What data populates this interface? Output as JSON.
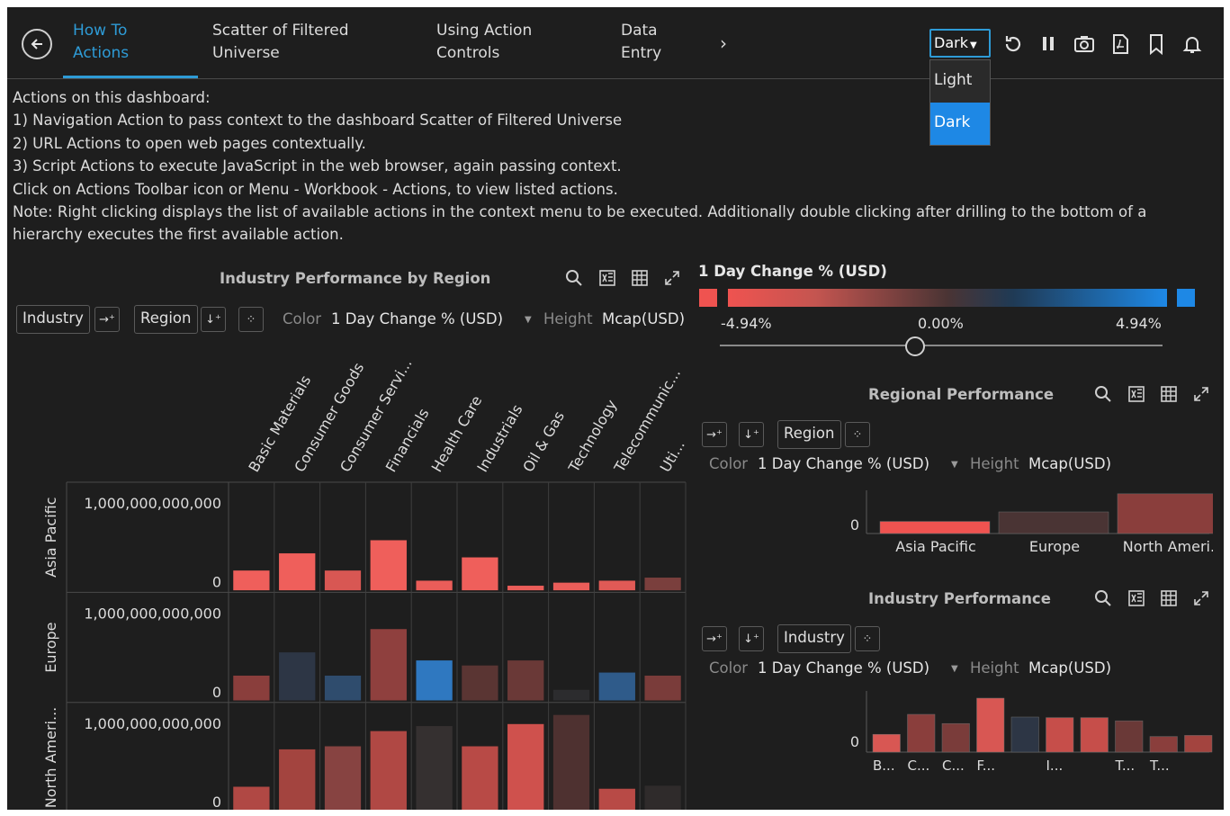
{
  "nav": {
    "tabs": [
      {
        "label_1": "How To",
        "label_2": "Actions"
      },
      {
        "label_1": "Scatter of Filtered",
        "label_2": "Universe"
      },
      {
        "label_1": "Using Action",
        "label_2": "Controls"
      },
      {
        "label_1": "Data",
        "label_2": "Entry"
      }
    ],
    "more": "›",
    "theme": {
      "selected": "Dark",
      "options": [
        "Light",
        "Dark"
      ]
    },
    "toolbar_icons": [
      "refresh-icon",
      "pause-icon",
      "camera-icon",
      "pdf-icon",
      "bookmark-icon",
      "bell-icon"
    ]
  },
  "description": {
    "lines": [
      "Actions on this dashboard:",
      "1) Navigation Action to pass context to the dashboard Scatter of Filtered Universe",
      "2) URL Actions to open web pages contextually.",
      "3) Script Actions to execute JavaScript in the web browser, again passing context.",
      "Click on Actions Toolbar icon or Menu - Workbook - Actions, to view listed actions.",
      "Note: Right clicking displays the list of available actions in the context menu to be executed.   Additionally double clicking after drilling to the bottom of a",
      "hierarchy executes the first available action."
    ]
  },
  "left_panel": {
    "title": "Industry Performance by Region",
    "dim1": "Industry",
    "dim2": "Region",
    "color_label": "Color",
    "color_value": "1 Day Change % (USD)",
    "height_label": "Height",
    "height_value": "Mcap(USD)"
  },
  "legend": {
    "title": "1 Day Change % (USD)",
    "min": "-4.94%",
    "mid": "0.00%",
    "max": "4.94%",
    "neg_color": "#ef5350",
    "pos_color": "#1e88e5"
  },
  "regional_panel": {
    "title": "Regional Performance",
    "dim": "Region",
    "color_label": "Color",
    "color_value": "1 Day Change % (USD)",
    "height_label": "Height",
    "height_value": "Mcap(USD)"
  },
  "industry_panel": {
    "title": "Industry Performance",
    "dim": "Industry",
    "color_label": "Color",
    "color_value": "1 Day Change % (USD)",
    "height_label": "Height",
    "height_value": "Mcap(USD)"
  },
  "chart_data": [
    {
      "type": "bar",
      "name": "Industry Performance by Region",
      "categories": [
        "Basic Materials",
        "Consumer Goods",
        "Consumer Servi...",
        "Financials",
        "Health Care",
        "Industrials",
        "Oil & Gas",
        "Technology",
        "Telecommunic...",
        "Uti..."
      ],
      "ytick_top": "1,000,000,000,000",
      "ytick_zero": "0",
      "rows": [
        {
          "label": "Asia Pacific",
          "values": [
            0.2,
            0.37,
            0.2,
            0.5,
            0.1,
            0.33,
            0.05,
            0.08,
            0.1,
            0.13
          ],
          "colors": [
            "#ef5f5b",
            "#ef5f5b",
            "#d85753",
            "#ef5f5b",
            "#ea5d59",
            "#ef5f5b",
            "#ea5d59",
            "#ea5d59",
            "#e05a56",
            "#7a3f3d"
          ]
        },
        {
          "label": "Europe",
          "values": [
            0.25,
            0.48,
            0.25,
            0.71,
            0.4,
            0.35,
            0.4,
            0.11,
            0.28,
            0.25
          ],
          "colors": [
            "#8a3e3c",
            "#2d3645",
            "#2f4c6d",
            "#8f403e",
            "#2f78c0",
            "#5a3533",
            "#6a3937",
            "#2c2c2e",
            "#2f5b8a",
            "#7a3c3a"
          ]
        },
        {
          "label": "North Ameri...",
          "values": [
            0.24,
            0.61,
            0.64,
            0.79,
            0.84,
            0.64,
            0.86,
            0.95,
            0.22,
            0.25
          ],
          "colors": [
            "#b04844",
            "#a3443f",
            "#874341",
            "#b04844",
            "#353030",
            "#b84a46",
            "#cf514d",
            "#4e3130",
            "#b84a46",
            "#2f2b2b"
          ]
        }
      ]
    },
    {
      "type": "bar",
      "name": "Regional Performance",
      "categories": [
        "Asia Pacific",
        "Europe",
        "North Ameri..."
      ],
      "ytick_zero": "0",
      "values": [
        0.28,
        0.5,
        0.92
      ],
      "colors": [
        "#ef5350",
        "#4a3434",
        "#8a3e3c"
      ]
    },
    {
      "type": "bar",
      "name": "Industry Performance",
      "tick_labels": [
        "B...",
        "C...",
        "C...",
        "F...",
        "",
        "I...",
        "",
        "T...",
        "T...",
        ""
      ],
      "ytick_zero": "0",
      "values": [
        0.33,
        0.7,
        0.53,
        1.0,
        0.65,
        0.64,
        0.64,
        0.58,
        0.29,
        0.31
      ],
      "colors": [
        "#d85753",
        "#8a3e3c",
        "#7a3c3a",
        "#d85753",
        "#2d3645",
        "#c64e4a",
        "#c64e4a",
        "#6a3937",
        "#8a3e3c",
        "#a3443f"
      ]
    }
  ]
}
